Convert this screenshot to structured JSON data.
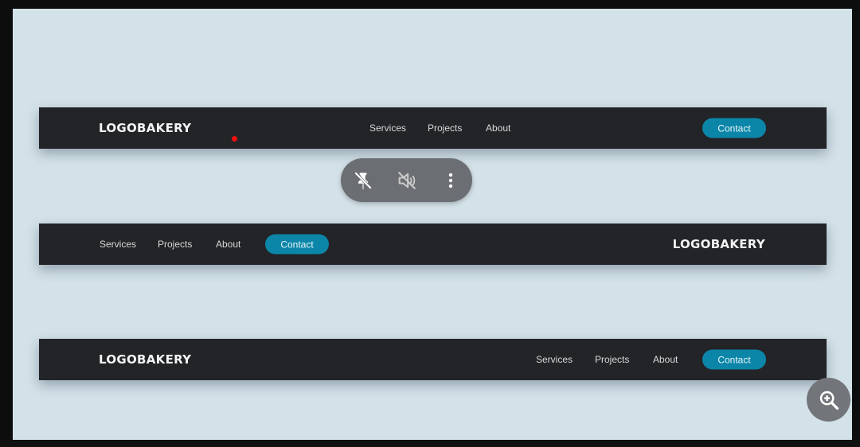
{
  "navbars": [
    {
      "logo": "LOGOBAKERY",
      "links": [
        "Services",
        "Projects",
        "About"
      ],
      "contact_label": "Contact"
    },
    {
      "logo": "LOGOBAKERY",
      "links": [
        "Services",
        "Projects",
        "About"
      ],
      "contact_label": "Contact"
    },
    {
      "logo": "LOGOBAKERY",
      "links": [
        "Services",
        "Projects",
        "About"
      ],
      "contact_label": "Contact"
    }
  ],
  "overlay_controls": {
    "icons": [
      "unpin-icon",
      "mute-icon",
      "more-vertical-icon"
    ]
  },
  "zoom_button": {
    "icon": "zoom-in-icon"
  },
  "colors": {
    "canvas": "#d3e1e8",
    "navbar": "#222428",
    "accent": "#0c86a8",
    "overlay": "#6b6e72"
  }
}
